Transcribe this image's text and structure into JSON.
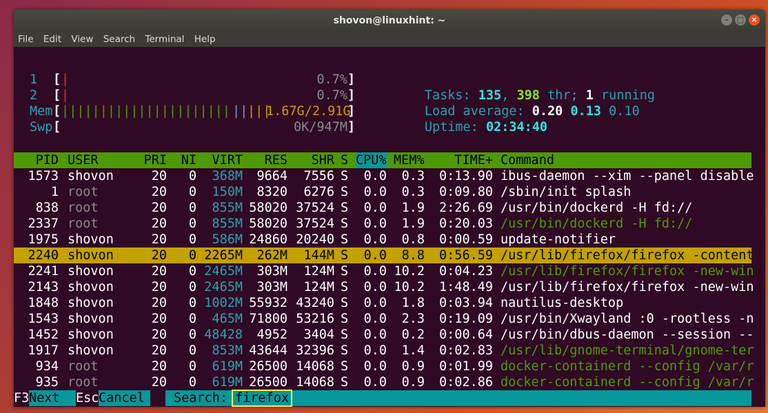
{
  "window": {
    "title": "shovon@linuxhint: ~"
  },
  "menu": [
    "File",
    "Edit",
    "View",
    "Search",
    "Terminal",
    "Help"
  ],
  "meters": {
    "cpu1": {
      "label": "1",
      "value": "0.7%"
    },
    "cpu2": {
      "label": "2",
      "value": "0.7%"
    },
    "mem": {
      "label": "Mem",
      "value": "1.67G/2.91G"
    },
    "swp": {
      "label": "Swp",
      "value": "0K/947M"
    }
  },
  "stats": {
    "tasks_label": "Tasks:",
    "tasks": "135",
    "threads": "398",
    "thr_label": "thr;",
    "running": "1",
    "running_label": "running",
    "load_label": "Load average:",
    "load1": "0.20",
    "load5": "0.13",
    "load15": "0.10",
    "uptime_label": "Uptime:",
    "uptime": "02:34:40"
  },
  "columns": [
    "PID",
    "USER",
    "PRI",
    "NI",
    "VIRT",
    "RES",
    "SHR",
    "S",
    "CPU%",
    "MEM%",
    "TIME+",
    "Command"
  ],
  "processes": [
    {
      "pid": "1573",
      "user": "shovon",
      "pri": "20",
      "ni": "0",
      "virt": "368M",
      "res": "9664",
      "shr": "7556",
      "s": "S",
      "cpu": "0.0",
      "mem": "0.3",
      "time": "0:13.90",
      "cmd": "ibus-daemon --xim --panel disable"
    },
    {
      "pid": "1",
      "user": "root",
      "pri": "20",
      "ni": "0",
      "virt": "150M",
      "res": "8320",
      "shr": "6276",
      "s": "S",
      "cpu": "0.0",
      "mem": "0.3",
      "time": "0:09.80",
      "cmd": "/sbin/init splash"
    },
    {
      "pid": "838",
      "user": "root",
      "pri": "20",
      "ni": "0",
      "virt": "855M",
      "res": "58020",
      "shr": "37524",
      "s": "S",
      "cpu": "0.0",
      "mem": "1.9",
      "time": "2:26.69",
      "cmd": "/usr/bin/dockerd -H fd://"
    },
    {
      "pid": "2337",
      "user": "root",
      "pri": "20",
      "ni": "0",
      "virt": "855M",
      "res": "58020",
      "shr": "37524",
      "s": "S",
      "cpu": "0.0",
      "mem": "1.9",
      "time": "0:20.03",
      "cmd": "/usr/bin/dockerd -H fd://"
    },
    {
      "pid": "1975",
      "user": "shovon",
      "pri": "20",
      "ni": "0",
      "virt": "586M",
      "res": "24860",
      "shr": "20240",
      "s": "S",
      "cpu": "0.0",
      "mem": "0.8",
      "time": "0:00.59",
      "cmd": "update-notifier"
    },
    {
      "pid": "2240",
      "user": "shovon",
      "pri": "20",
      "ni": "0",
      "virt": "2265M",
      "res": "262M",
      "shr": "144M",
      "s": "S",
      "cpu": "0.0",
      "mem": "8.8",
      "time": "0:56.59",
      "cmd": "/usr/lib/firefox/firefox -content"
    },
    {
      "pid": "2241",
      "user": "shovon",
      "pri": "20",
      "ni": "0",
      "virt": "2465M",
      "res": "303M",
      "shr": "124M",
      "s": "S",
      "cpu": "0.0",
      "mem": "10.2",
      "time": "0:04.23",
      "cmd": "/usr/lib/firefox/firefox -new-win"
    },
    {
      "pid": "2143",
      "user": "shovon",
      "pri": "20",
      "ni": "0",
      "virt": "2465M",
      "res": "303M",
      "shr": "124M",
      "s": "S",
      "cpu": "0.0",
      "mem": "10.2",
      "time": "1:48.49",
      "cmd": "/usr/lib/firefox/firefox -new-win"
    },
    {
      "pid": "1848",
      "user": "shovon",
      "pri": "20",
      "ni": "0",
      "virt": "1002M",
      "res": "55932",
      "shr": "43240",
      "s": "S",
      "cpu": "0.0",
      "mem": "1.8",
      "time": "0:03.94",
      "cmd": "nautilus-desktop"
    },
    {
      "pid": "1543",
      "user": "shovon",
      "pri": "20",
      "ni": "0",
      "virt": "465M",
      "res": "71800",
      "shr": "53216",
      "s": "S",
      "cpu": "0.0",
      "mem": "2.3",
      "time": "0:19.09",
      "cmd": "/usr/bin/Xwayland :0 -rootless -n"
    },
    {
      "pid": "1452",
      "user": "shovon",
      "pri": "20",
      "ni": "0",
      "virt": "48428",
      "res": "4952",
      "shr": "3404",
      "s": "S",
      "cpu": "0.0",
      "mem": "0.2",
      "time": "0:00.64",
      "cmd": "/usr/bin/dbus-daemon --session --"
    },
    {
      "pid": "1917",
      "user": "shovon",
      "pri": "20",
      "ni": "0",
      "virt": "853M",
      "res": "43644",
      "shr": "32396",
      "s": "S",
      "cpu": "0.0",
      "mem": "1.4",
      "time": "0:02.83",
      "cmd": "/usr/lib/gnome-terminal/gnome-ter"
    },
    {
      "pid": "934",
      "user": "root",
      "pri": "20",
      "ni": "0",
      "virt": "619M",
      "res": "26500",
      "shr": "14068",
      "s": "S",
      "cpu": "0.0",
      "mem": "0.9",
      "time": "0:01.99",
      "cmd": "docker-containerd --config /var/r"
    },
    {
      "pid": "935",
      "user": "root",
      "pri": "20",
      "ni": "0",
      "virt": "619M",
      "res": "26500",
      "shr": "14068",
      "s": "S",
      "cpu": "0.0",
      "mem": "0.9",
      "time": "0:02.86",
      "cmd": "docker-containerd --config /var/r"
    }
  ],
  "footer": {
    "next_key": "F3",
    "next_label": "Next",
    "cancel_key": "Esc",
    "cancel_label": "Cancel",
    "search_label": "Search:",
    "search_value": "firefox"
  }
}
